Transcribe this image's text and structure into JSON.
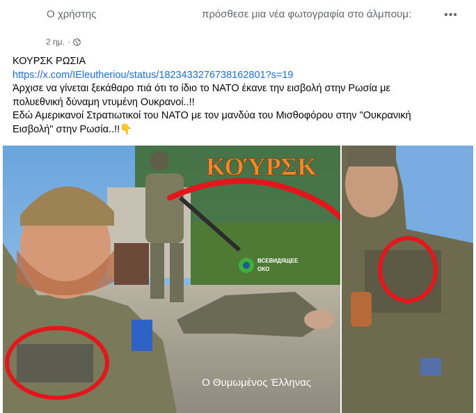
{
  "header": {
    "author": "Ο χρήστης",
    "action": "πρόσθεσε μια νέα φωτογραφία στο άλμπουμ:",
    "more_icon": "more-horizontal-icon",
    "more_glyph": "•••"
  },
  "meta": {
    "time": "2 ημ.",
    "separator": "·",
    "privacy_icon": "globe-icon"
  },
  "post": {
    "title": "ΚΟΥΡΣΚ   ΡΩΣΙΑ",
    "link": "https://x.com/IEleutheriou/status/1823433276738162801?s=19",
    "body_line1": "Άρχισε να γίνεται ξεκάθαρο πιά ότι το ίδιο το ΝΑΤΟ έκανε την εισβολή στην Ρωσία με",
    "body_line2": "πολυεθνική δύναμη ντυμένη Ουκρανοί..!!",
    "body_line3": " Εδώ Αμερικανοί Στρατιωτικοί του ΝΑΤΟ με τον μανδύα του Μισθοφόρου στην  \"Ουκρανική",
    "body_line4": "Εισβολή\" στην Ρωσία..!!👇"
  },
  "photo": {
    "caption_title": "ΚΟΎΡΣΚ",
    "watermark_line1": "ВСЕВИДЯЩЕЕ",
    "watermark_line2": "ОКО",
    "credit": "Ο Θυμωμένος Έλληνας",
    "colors": {
      "sky": "#7fb2e0",
      "title_orange": "#f08a2c",
      "annotation_red": "#e3161b",
      "uniform": "#7a7a5a"
    }
  }
}
